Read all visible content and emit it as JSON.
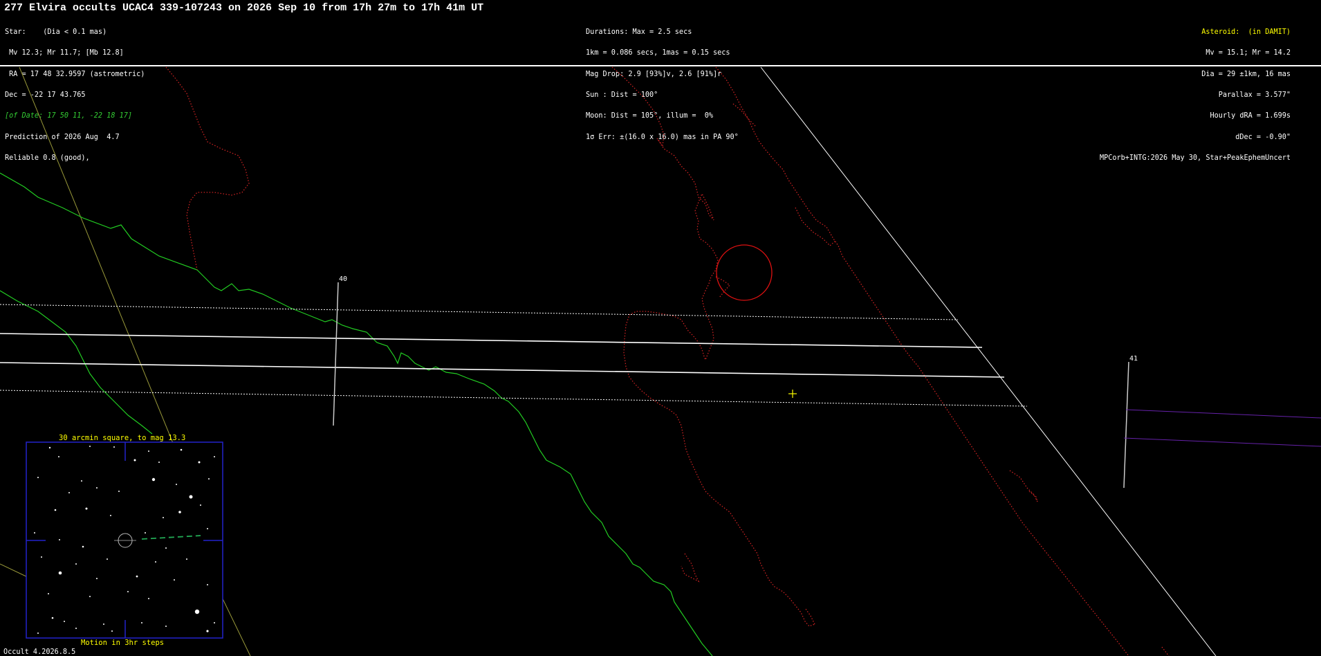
{
  "header": {
    "title": "277 Elvira occults UCAC4 339-107243 on 2026 Sep 10 from 17h 27m to 17h 41m UT",
    "star": [
      "Star:    (Dia < 0.1 mas)",
      " Mv 12.3; Mr 11.7; [Mb 12.8]",
      " RA = 17 48 32.9597 (astrometric)",
      "Dec = -22 17 43.765",
      "[of Date: 17 50 11, -22 18 17]",
      "Prediction of 2026 Aug  4.7",
      "Reliable 0.8 (good),"
    ],
    "event": [
      "Durations: Max = 2.5 secs",
      "1km = 0.086 secs, 1mas = 0.15 secs",
      "Mag Drop: 2.9 [93%]v, 2.6 [91%]r",
      "Sun : Dist = 100°",
      "Moon: Dist = 105°, illum =  0%",
      "1σ Err: ±(16.0 x 16.0) mas in PA 90°"
    ],
    "asteroid": [
      "Asteroid:  (in DAMIT)",
      "Mv = 15.1; Mr = 14.2",
      "Dia = 29 ±1km, 16 mas",
      "Parallax = 3.577\"",
      "Hourly dRA = 1.699s",
      "dDec = -0.90\"",
      "MPCorb+INTG:2026 May 30, Star+PeakEphemUncert"
    ]
  },
  "map": {
    "time_labels": [
      "40",
      "41"
    ],
    "colors": {
      "coast": "#cc2222",
      "green_line": "#22cc22",
      "path": "#ffffff",
      "grid": "#9a9a3a",
      "purple": "#6622aa",
      "marker": "#ffff00"
    }
  },
  "inset": {
    "caption_top": "30 arcmin square, to mag 13.3",
    "caption_bottom": "Motion in 3hr steps",
    "border_color": "#2222cc"
  },
  "footer": {
    "version": "Occult 4.2026.8.5"
  }
}
